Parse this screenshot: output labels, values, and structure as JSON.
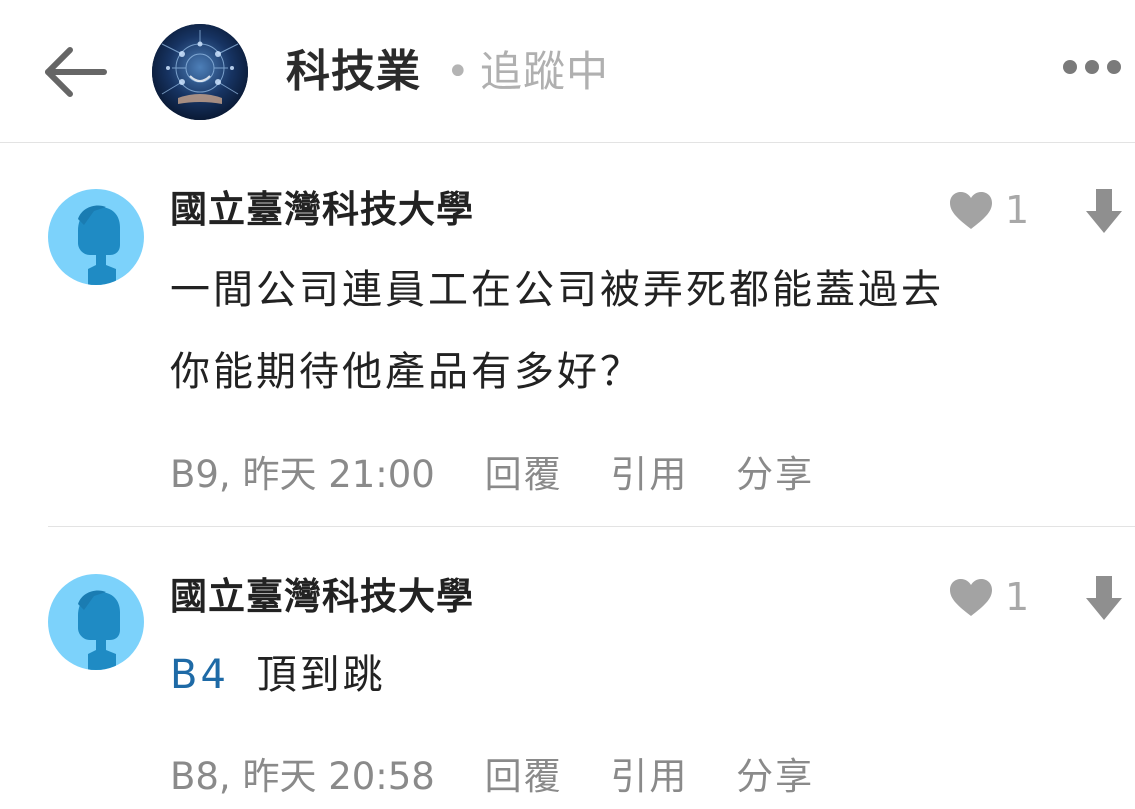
{
  "header": {
    "board_name": "科技業",
    "separator": "•",
    "follow_status": "追蹤中"
  },
  "comments": [
    {
      "author": "國立臺灣科技大學",
      "likes": "1",
      "lines": [
        "一間公司連員工在公司被弄死都能蓋過去",
        "你能期待他產品有多好？"
      ],
      "floor_time": "B9, 昨天 21:00",
      "actions": {
        "reply": "回覆",
        "quote": "引用",
        "share": "分享"
      }
    },
    {
      "author": "國立臺灣科技大學",
      "likes": "1",
      "reply_ref": "B4",
      "text": "頂到跳",
      "floor_time": "B8, 昨天 20:58",
      "actions": {
        "reply": "回覆",
        "quote": "引用",
        "share": "分享"
      }
    }
  ],
  "colors": {
    "avatar_bg": "#7cd2fb",
    "avatar_figure": "#1f8bc4",
    "link": "#1e6aa6",
    "muted": "#a8a8a8"
  }
}
